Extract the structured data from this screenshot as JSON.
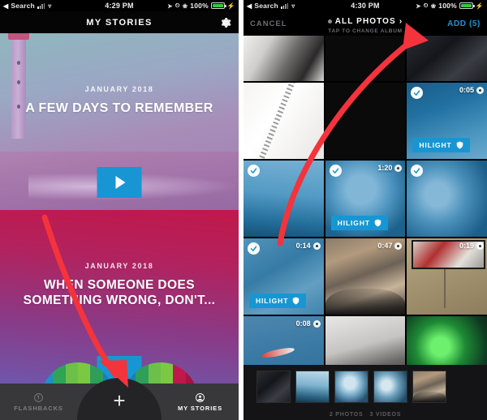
{
  "left_phone": {
    "status_bar": {
      "back_glyph": "◀",
      "carrier_label": "Search",
      "wifi_icon": "wifi-icon",
      "time": "4:29 PM",
      "location_icon": "location-arrow-icon",
      "alarm_icon": "alarm-clock-icon",
      "bluetooth_icon": "bluetooth-icon",
      "battery_percent": "100%",
      "battery_icon": "battery-full-icon",
      "charging_icon": "lightning-bolt-icon"
    },
    "navbar": {
      "title": "MY STORIES",
      "settings_icon": "gear-icon"
    },
    "stories": [
      {
        "date_label": "JANUARY 2018",
        "headline": "A FEW DAYS TO REMEMBER",
        "play_icon": "play-icon",
        "accent_color": "#1896d3"
      },
      {
        "date_label": "JANUARY 2018",
        "headline": "WHEN SOMEONE DOES SOMETHING WRONG, DON'T...",
        "play_icon": "play-icon",
        "accent_color": "#1896d3"
      }
    ],
    "tabbar": {
      "tabs": [
        {
          "label": "FLASHBACKS",
          "icon": "flashbacks-icon",
          "active": false
        },
        {
          "label": "MY STORIES",
          "icon": "person-circle-icon",
          "active": true
        }
      ],
      "add_button": {
        "label": "+",
        "icon": "plus-icon"
      }
    }
  },
  "right_phone": {
    "status_bar": {
      "back_glyph": "◀",
      "carrier_label": "Search",
      "wifi_icon": "wifi-icon",
      "time": "4:30 PM",
      "location_icon": "location-arrow-icon",
      "alarm_icon": "alarm-clock-icon",
      "bluetooth_icon": "bluetooth-icon",
      "battery_percent": "100%",
      "battery_icon": "battery-full-icon",
      "charging_icon": "lightning-bolt-icon"
    },
    "navbar": {
      "cancel_label": "CANCEL",
      "album_label": "ALL PHOTOS",
      "album_chevron_icon": "chevron-down-icon",
      "album_subtitle": "TAP TO CHANGE ALBUM",
      "add_label": "ADD (5)",
      "add_color": "#1896d3"
    },
    "grid": {
      "rows": [
        [
          {
            "art": "ph-bw1",
            "selected": false,
            "duration": "",
            "hilight": ""
          },
          {
            "art": "ph-black",
            "selected": false,
            "duration": "",
            "hilight": ""
          },
          {
            "art": "ph-desk",
            "selected": false,
            "duration": "",
            "hilight": ""
          }
        ],
        [
          {
            "art": "ph-note",
            "selected": false,
            "duration": "",
            "hilight": ""
          },
          {
            "art": "ph-black",
            "selected": false,
            "duration": "",
            "hilight": ""
          },
          {
            "art": "ph-cockpit",
            "selected": true,
            "duration": "0:05",
            "hilight": "HILIGHT"
          }
        ],
        [
          {
            "art": "ph-sky",
            "selected": true,
            "duration": "",
            "hilight": ""
          },
          {
            "art": "ph-girl",
            "selected": true,
            "duration": "1:20",
            "hilight": "HILIGHT"
          },
          {
            "art": "ph-couple",
            "selected": true,
            "duration": "",
            "hilight": ""
          }
        ],
        [
          {
            "art": "ph-aerial1",
            "selected": true,
            "duration": "0:14",
            "hilight": "HILIGHT"
          },
          {
            "art": "ph-canyon",
            "selected": false,
            "duration": "0:47",
            "hilight": ""
          },
          {
            "art": "ph-wall",
            "selected": false,
            "duration": "0:19",
            "hilight": ""
          }
        ],
        [
          {
            "art": "ph-kayak",
            "selected": false,
            "duration": "0:08",
            "hilight": ""
          },
          {
            "art": "ph-bwgroup",
            "selected": false,
            "duration": "",
            "hilight": ""
          },
          {
            "art": "ph-green",
            "selected": false,
            "duration": "",
            "hilight": ""
          }
        ]
      ],
      "check_icon": "checkmark-icon",
      "video_icon": "video-dot-icon",
      "hilight_icon": "shield-icon"
    },
    "selected_strip": {
      "thumbs": [
        "ph-desk",
        "ph-sky",
        "ph-girl",
        "ph-couple",
        "ph-canyon"
      ]
    },
    "counts": {
      "photos": "2 PHOTOS",
      "videos": "3 VIDEOS"
    }
  },
  "annotations": {
    "arrow_color": "#f4333c",
    "arrows": [
      {
        "name": "arrow-to-add-button",
        "target": "ADD (5)"
      },
      {
        "name": "arrow-to-plus-button",
        "target": "+"
      }
    ]
  }
}
